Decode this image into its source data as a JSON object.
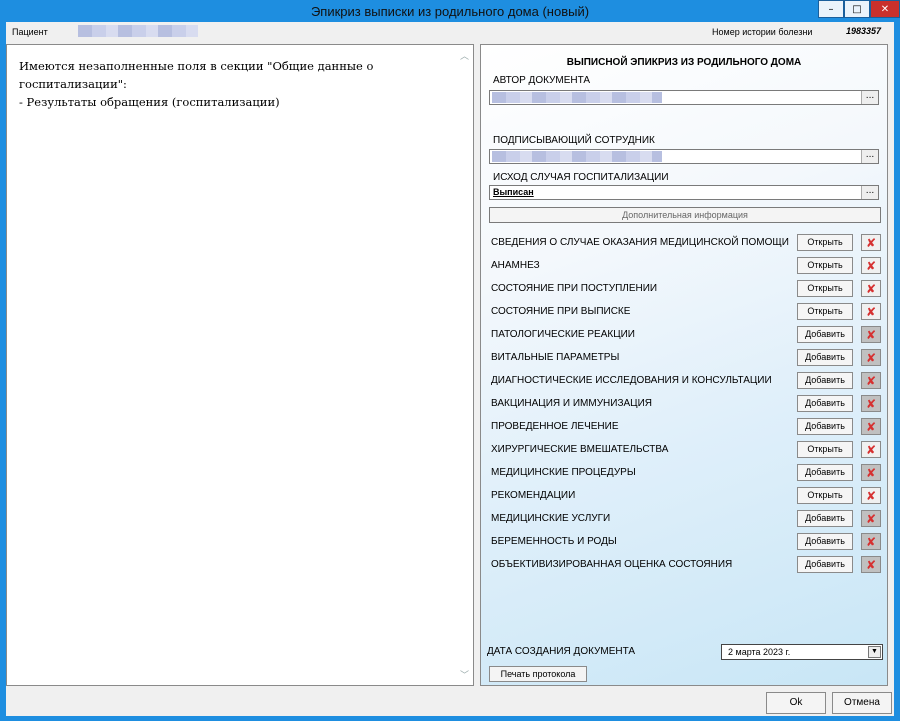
{
  "window": {
    "title": "Эпикриз выписки из родильного дома (новый)",
    "controls": {
      "minimize": "–",
      "maximize": "□",
      "close": "✕"
    }
  },
  "header": {
    "patient_label": "Пациент",
    "history_label": "Номер истории болезни",
    "history_value": "1983357"
  },
  "left_pane": {
    "line1": "Имеются незаполненные поля в секции \"Общие данные о госпитализации\":",
    "line2": "- Результаты обращения (госпитализации)"
  },
  "right_pane": {
    "title": "ВЫПИСНОЙ ЭПИКРИЗ ИЗ РОДИЛЬНОГО ДОМА",
    "author_label": "АВТОР ДОКУМЕНТА",
    "signer_label": "ПОДПИСЫВАЮЩИЙ СОТРУДНИК",
    "outcome_label": "ИСХОД СЛУЧАЯ ГОСПИТАЛИЗАЦИИ",
    "outcome_value": "Выписан",
    "ellipsis": "...",
    "extra_info": "Дополнительная информация",
    "sections": [
      {
        "label": "СВЕДЕНИЯ О СЛУЧАЕ ОКАЗАНИЯ МЕДИЦИНСКОЙ ПОМОЩИ",
        "button": "Открыть"
      },
      {
        "label": "АНАМНЕЗ",
        "button": "Открыть"
      },
      {
        "label": "СОСТОЯНИЕ ПРИ ПОСТУПЛЕНИИ",
        "button": "Открыть"
      },
      {
        "label": "СОСТОЯНИЕ ПРИ ВЫПИСКЕ",
        "button": "Открыть"
      },
      {
        "label": "ПАТОЛОГИЧЕСКИЕ РЕАКЦИИ",
        "button": "Добавить"
      },
      {
        "label": "ВИТАЛЬНЫЕ ПАРАМЕТРЫ",
        "button": "Добавить"
      },
      {
        "label": "ДИАГНОСТИЧЕСКИЕ ИССЛЕДОВАНИЯ И КОНСУЛЬТАЦИИ",
        "button": "Добавить"
      },
      {
        "label": "ВАКЦИНАЦИЯ И ИММУНИЗАЦИЯ",
        "button": "Добавить"
      },
      {
        "label": "ПРОВЕДЕННОЕ ЛЕЧЕНИЕ",
        "button": "Добавить"
      },
      {
        "label": "ХИРУРГИЧЕСКИЕ ВМЕШАТЕЛЬСТВА",
        "button": "Открыть"
      },
      {
        "label": "МЕДИЦИНСКИЕ ПРОЦЕДУРЫ",
        "button": "Добавить"
      },
      {
        "label": "РЕКОМЕНДАЦИИ",
        "button": "Открыть"
      },
      {
        "label": "МЕДИЦИНСКИЕ УСЛУГИ",
        "button": "Добавить"
      },
      {
        "label": "БЕРЕМЕННОСТЬ И РОДЫ",
        "button": "Добавить"
      },
      {
        "label": "ОБЪЕКТИВИЗИРОВАННАЯ ОЦЕНКА СОСТОЯНИЯ",
        "button": "Добавить"
      }
    ],
    "date_label": "ДАТА СОЗДАНИЯ ДОКУМЕНТА",
    "date_value": "2  марта  2023 г.",
    "date_dropdown": "▼",
    "print_button": "Печать протокола"
  },
  "footer": {
    "ok": "Ok",
    "cancel": "Отмена"
  },
  "colors": {
    "window_border": "#1e8ee0",
    "close_button": "#c9302c",
    "delete_icon": "#d63030"
  }
}
